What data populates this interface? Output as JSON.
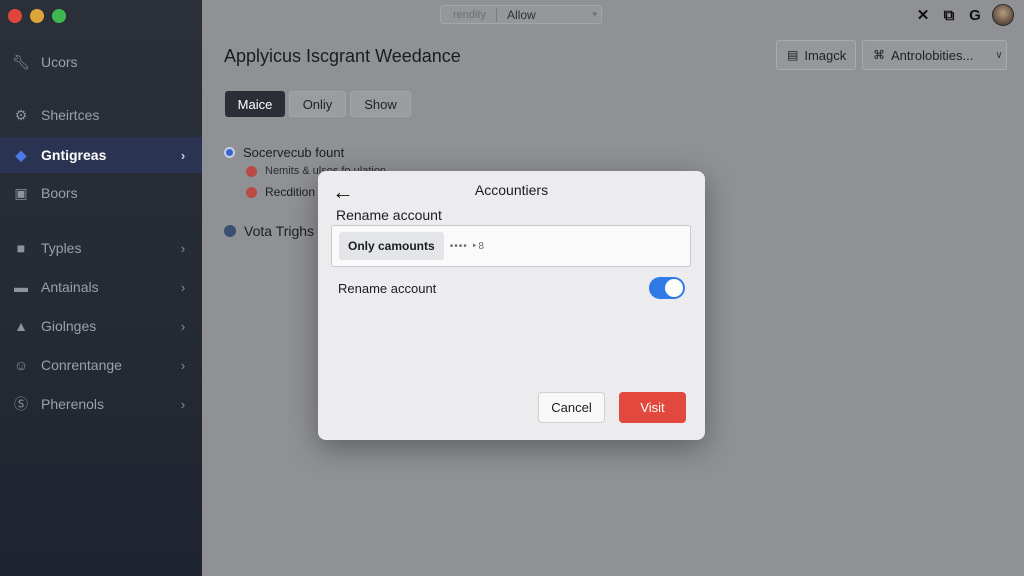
{
  "sidebar": {
    "items": [
      {
        "label": "Ucors",
        "icon": "wrench-icon",
        "chevron": false
      },
      {
        "label": "Sheirtces",
        "icon": "gear-icon",
        "chevron": false
      },
      {
        "label": "Gntigreas",
        "icon": "diamond-icon",
        "chevron": true,
        "active": true
      },
      {
        "label": "Boors",
        "icon": "box-icon",
        "chevron": false
      },
      {
        "label": "Typles",
        "icon": "folder-icon",
        "chevron": true
      },
      {
        "label": "Antainals",
        "icon": "inbox-icon",
        "chevron": true
      },
      {
        "label": "Giolnges",
        "icon": "triangle-icon",
        "chevron": true
      },
      {
        "label": "Conrentange",
        "icon": "smiley-icon",
        "chevron": true
      },
      {
        "label": "Pherenols",
        "icon": "dollar-circle-icon",
        "chevron": true
      }
    ]
  },
  "topbar": {
    "search_placeholder": "rendity",
    "search_value": "Allow",
    "icons": [
      "close-icon",
      "window-icon",
      "google-icon",
      "avatar"
    ]
  },
  "main": {
    "title": "Applyicus Iscgrant Weedance",
    "header_buttons": {
      "imagck_label": "Imagck",
      "antrolobities_label": "Antrolobities..."
    },
    "segments": [
      "Maice",
      "Onliy",
      "Show"
    ],
    "tree": {
      "root_label": "Socervecub fount",
      "child1_label": "Nemits & ulsos fo ulation",
      "child2_label": "Recdition",
      "second_root_label": "Vota Trighs"
    }
  },
  "modal": {
    "title": "Accountiers",
    "field_label": "Rename account",
    "field_chip": "Only camounts",
    "field_value": "•••• ‣8",
    "toggle_label": "Rename account",
    "toggle_on": true,
    "cancel_label": "Cancel",
    "visit_label": "Visit"
  },
  "colors": {
    "accent": "#2f7ae5",
    "danger": "#e2483d",
    "sidebar_bg": "#272c35",
    "active_item_bg": "#2b3352"
  }
}
